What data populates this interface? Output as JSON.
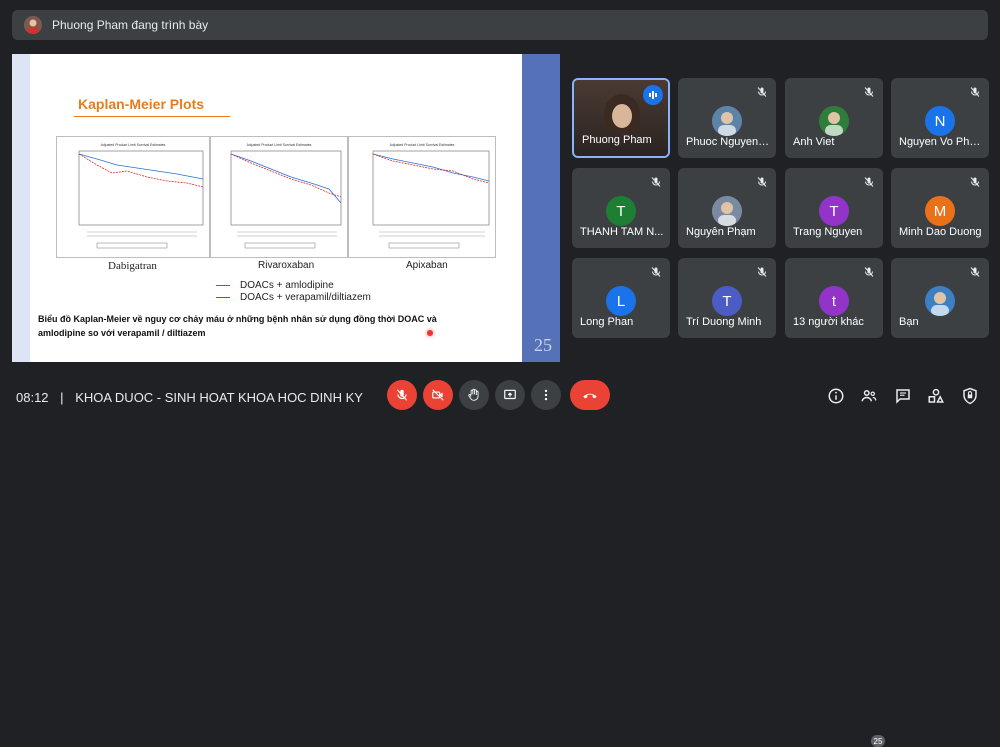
{
  "presenter_bar": {
    "title": "Phuong Pham đang trình bày"
  },
  "slide": {
    "title": "Kaplan-Meier Plots",
    "page_number": "25",
    "plot_titles": [
      "Adjusted Product Limit Survival Estimates",
      "Adjusted Product Limit Survival Estimates",
      "Adjusted Product Limit Survival Estimates"
    ],
    "drug_labels": [
      "Dabigatran",
      "Rivaroxaban",
      "Apixaban"
    ],
    "legend": [
      "DOACs + amlodipine",
      "DOACs + verapamil/diltiazem"
    ],
    "caption": "Biểu đồ Kaplan-Meier về nguy cơ chảy máu ở những bệnh nhân sử dụng đồng thời DOAC và amlodipine so với verapamil / diltiazem",
    "colors": {
      "title": "#e87d1e",
      "line_blue": "#2a6edb",
      "line_red": "#d62a2a"
    }
  },
  "participants": [
    {
      "name": "Phuong Pham",
      "initial": "",
      "color": "#8a6d5a",
      "speaking": true
    },
    {
      "name": "Phuoc Nguyen ...",
      "initial": "",
      "color": "#5d84a8"
    },
    {
      "name": "Anh Viet",
      "initial": "",
      "color": "#2f7d3a"
    },
    {
      "name": "Nguyen Vo Phu...",
      "initial": "N",
      "color": "#1a73e8"
    },
    {
      "name": "THANH TAM N...",
      "initial": "T",
      "color": "#1e7e34"
    },
    {
      "name": "Nguyên Phạm",
      "initial": "",
      "color": "#7a8aa0"
    },
    {
      "name": "Trang Nguyen",
      "initial": "T",
      "color": "#9334c9"
    },
    {
      "name": "Minh Dao Duong",
      "initial": "M",
      "color": "#e8711a"
    },
    {
      "name": "Long Phan",
      "initial": "L",
      "color": "#1a73e8"
    },
    {
      "name": "Trí Duong Minh",
      "initial": "T",
      "color": "#4b5dc5"
    },
    {
      "name": "13 người khác",
      "initial": "t",
      "color": "#9334c9"
    },
    {
      "name": "Bạn",
      "initial": "",
      "color": "#3c7fc2"
    }
  ],
  "meeting": {
    "time": "08:12",
    "separator": "|",
    "title": "KHOA DUOC - SINH HOAT KHOA HOC DINH KY",
    "participant_count": "25"
  },
  "controls": {
    "mic": "mic-off-icon",
    "camera": "camera-off-icon",
    "raise_hand": "hand-icon",
    "present": "present-icon",
    "more": "more-vert-icon",
    "end_call": "end-call-icon"
  },
  "right_icons": [
    "info-icon",
    "people-icon",
    "chat-icon",
    "activities-icon",
    "host-controls-icon"
  ]
}
